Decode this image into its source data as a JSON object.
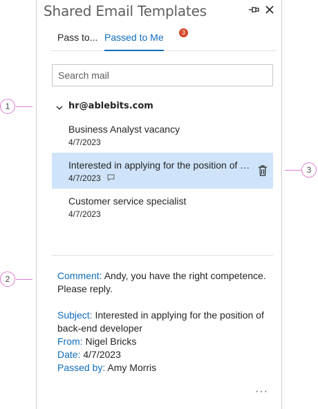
{
  "callouts": [
    "1",
    "2",
    "3"
  ],
  "pane": {
    "title": "Shared Email Templates"
  },
  "tabs": [
    {
      "label": "Pass to..."
    },
    {
      "label": "Passed to Me",
      "badge": "3"
    }
  ],
  "search": {
    "placeholder": "Search mail",
    "value": ""
  },
  "group": {
    "label": "hr@ablebits.com"
  },
  "items": [
    {
      "subject": "Business Analyst vacancy",
      "date": "4/7/2023"
    },
    {
      "subject": "Interested in applying for the position of back-end developer",
      "date": "4/7/2023"
    },
    {
      "subject": "Customer service specialist",
      "date": "4/7/2023"
    }
  ],
  "details": {
    "comment_key": "Comment:",
    "comment_value": "Andy, you have the right competence. Please reply.",
    "subject_key": "Subject:",
    "subject_value": "Interested in applying for the position of back-end developer",
    "from_key": "From:",
    "from_value": "Nigel Bricks",
    "date_key": "Date:",
    "date_value": "4/7/2023",
    "passed_key": "Passed by:",
    "passed_value": "Amy Morris"
  },
  "more_label": "···",
  "colors": {
    "accent": "#0f6cbd",
    "selected": "#cfe4fa",
    "badge": "#d8472b",
    "callout": "#e07bd4"
  },
  "icons": [
    "pin-icon",
    "close-icon",
    "chevron-down-icon",
    "comment-icon",
    "trash-icon"
  ]
}
